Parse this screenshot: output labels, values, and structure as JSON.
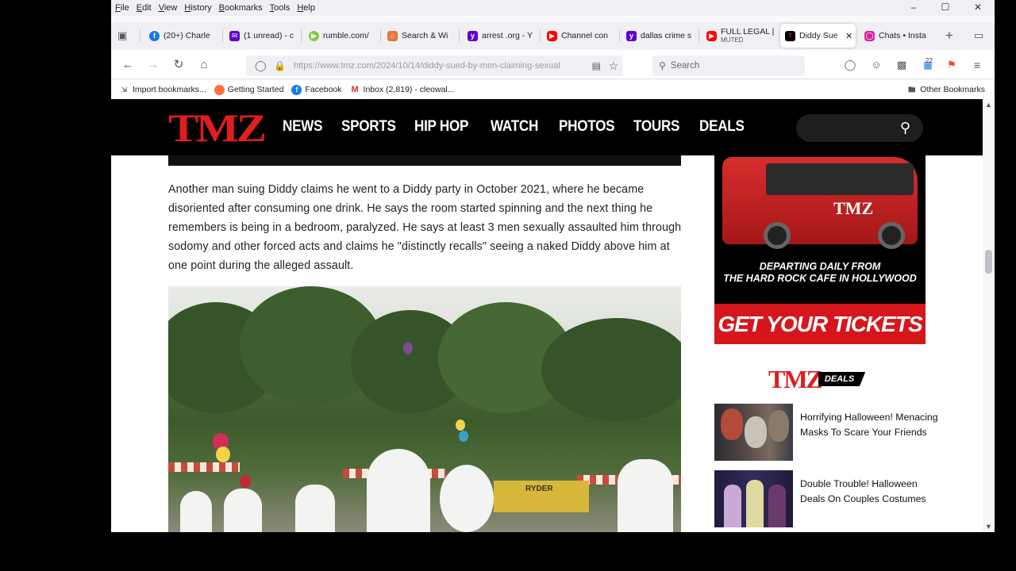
{
  "menubar": {
    "items": [
      "File",
      "Edit",
      "View",
      "History",
      "Bookmarks",
      "Tools",
      "Help"
    ]
  },
  "tabs": [
    {
      "title": "(20+) Charle",
      "icon": "facebook-icon",
      "color": "#1877f2"
    },
    {
      "title": "(1 unread) - c",
      "icon": "mail-icon",
      "color": "#6001d2"
    },
    {
      "title": "rumble.com/",
      "icon": "rumble-icon",
      "color": "#85c742"
    },
    {
      "title": "Search & Wi",
      "icon": "search-app-icon",
      "color": "#e8743b"
    },
    {
      "title": "arrest .org - Y",
      "icon": "yahoo-icon",
      "color": "#6001d2"
    },
    {
      "title": "Channel con",
      "icon": "youtube-icon",
      "color": "#ff0000"
    },
    {
      "title": "dallas crime s",
      "icon": "yahoo-icon",
      "color": "#6001d2"
    },
    {
      "title": "FULL LEGAL |",
      "subtitle": "MUTED",
      "icon": "youtube-icon",
      "color": "#ff0000"
    },
    {
      "title": "Diddy Sue",
      "icon": "tmz-icon",
      "color": "#e11d1d",
      "active": true
    },
    {
      "title": "Chats • Insta",
      "icon": "instagram-icon",
      "color": "#d6249f"
    }
  ],
  "navbar": {
    "url": "https://www.tmz.com/2024/10/14/diddy-sued-by-men-claiming-sexual",
    "search_placeholder": "Search",
    "notification_count": "22"
  },
  "bookmarks": [
    {
      "label": "Import bookmarks...",
      "icon": "import-icon"
    },
    {
      "label": "Getting Started",
      "icon": "firefox-icon"
    },
    {
      "label": "Facebook",
      "icon": "facebook-icon"
    },
    {
      "label": "Inbox (2,819) - cleowal...",
      "icon": "gmail-icon"
    }
  ],
  "other_bookmarks": "Other Bookmarks",
  "site": {
    "logo": "TMZ",
    "nav": [
      "NEWS",
      "SPORTS",
      "HIP HOP",
      "WATCH",
      "PHOTOS",
      "TOURS",
      "DEALS"
    ]
  },
  "article": {
    "paragraph": "Another man suing Diddy claims he went to a Diddy party in October 2021, where he became disoriented after consuming one drink. He says the room started spinning and the next thing he remembers is being in a bedroom, paralyzed. He says at least 3 men sexually assaulted him through sodomy and other forced acts and claims he \"distinctly recalls\" seeing a naked Diddy above him at one point during the alleged assault."
  },
  "ad": {
    "line1": "DEPARTING DAILY FROM",
    "line2": "THE HARD ROCK CAFE IN HOLLYWOOD",
    "cta": "GET YOUR TICKETS",
    "bus_logo": "TMZ"
  },
  "deals": {
    "logo": "TMZ",
    "tag": "DEALS",
    "items": [
      {
        "title": "Horrifying Halloween! Menacing Masks To Scare Your Friends"
      },
      {
        "title": "Double Trouble! Halloween Deals On Couples Costumes"
      }
    ]
  },
  "photo": {
    "truck_text": "RYDER"
  }
}
